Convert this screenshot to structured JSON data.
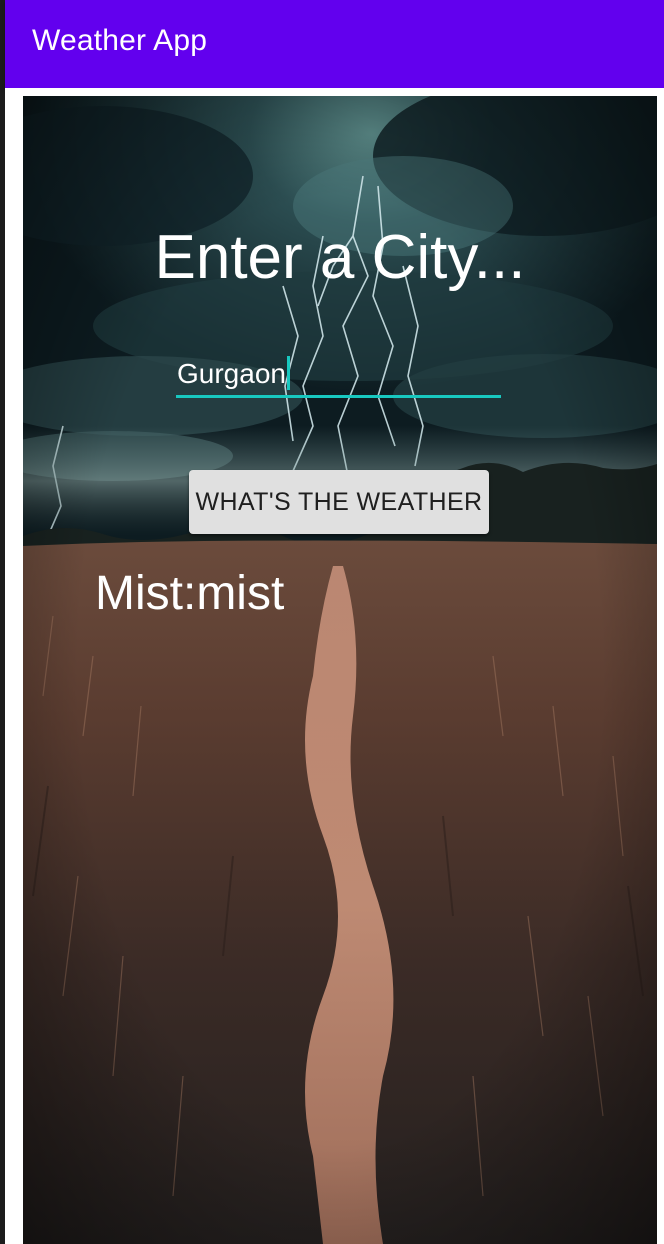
{
  "app_bar": {
    "title": "Weather App",
    "color": "#6200ee"
  },
  "main": {
    "background_image": "stormy-field-path-photo",
    "heading": "Enter a City...",
    "city_input": {
      "value": "Gurgaon",
      "underline_color": "#18c8c0"
    },
    "weather_button_label": "WHAT'S THE WEATHER",
    "result_text": "Mist:mist"
  }
}
